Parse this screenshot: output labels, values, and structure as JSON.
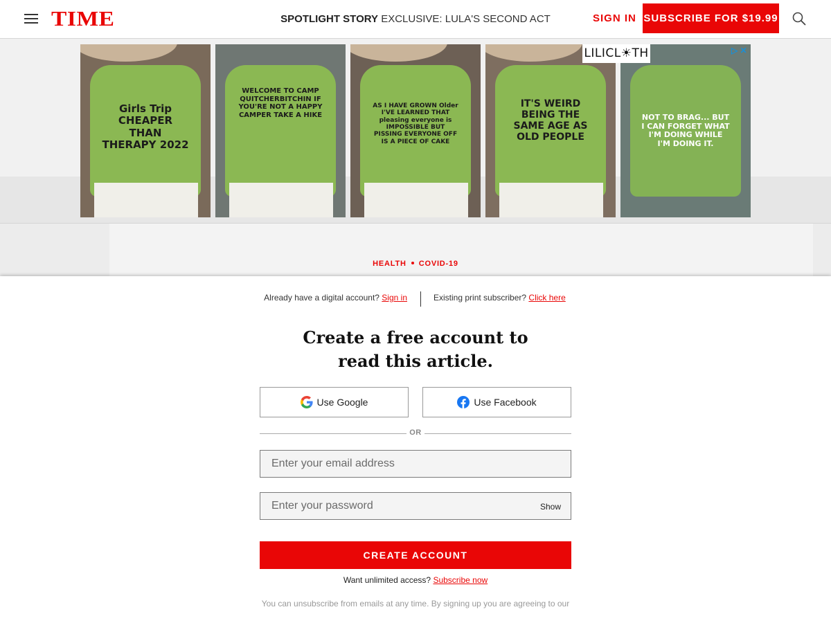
{
  "header": {
    "logo": "TIME",
    "spotlight_label": "SPOTLIGHT STORY",
    "spotlight_story": "EXCLUSIVE: LULA'S SECOND ACT",
    "sign_in": "SIGN IN",
    "subscribe": "SUBSCRIBE FOR $19.99",
    "menu_icon": "hamburger-menu-icon",
    "search_icon": "search-icon"
  },
  "ad": {
    "brand": "LILICL☀TH",
    "controls": "▷ ✕",
    "tiles": [
      {
        "text": "Girls Trip CHEAPER THAN THERAPY 2022"
      },
      {
        "text": "WELCOME TO CAMP QUITCHERBITCHIN IF YOU'RE NOT A HAPPY CAMPER TAKE A HIKE"
      },
      {
        "text": "AS I HAVE GROWN Older I'VE LEARNED THAT pleasing everyone is IMPOSSIBLE BUT PISSING EVERYONE OFF IS A PIECE OF CAKE"
      },
      {
        "text": "IT'S WEIRD BEING THE SAME AGE AS OLD PEOPLE"
      },
      {
        "text": "NOT TO BRAG... BUT I CAN FORGET WHAT I'M DOING WHILE I'M DOING IT."
      }
    ]
  },
  "article": {
    "section": "HEALTH",
    "topic": "COVID-19"
  },
  "paywall": {
    "digital_prompt": "Already have a digital account?",
    "digital_link": "Sign in",
    "print_prompt": "Existing print subscriber?",
    "print_link": "Click here",
    "headline_line1": "Create a free account to",
    "headline_line2": "read this article.",
    "google_label": "Use Google",
    "facebook_label": "Use Facebook",
    "or_label": "OR",
    "email_placeholder": "Enter your email address",
    "password_placeholder": "Enter your password",
    "show_label": "Show",
    "create_label": "CREATE ACCOUNT",
    "unlimited_prompt": "Want unlimited access?",
    "unlimited_link": "Subscribe now",
    "fineprint": "You can unsubscribe from emails at any time. By signing up you are agreeing to our"
  },
  "colors": {
    "brand_red": "#e90606",
    "facebook_blue": "#1877f2",
    "ad_shirt_green": "#8bb853"
  }
}
